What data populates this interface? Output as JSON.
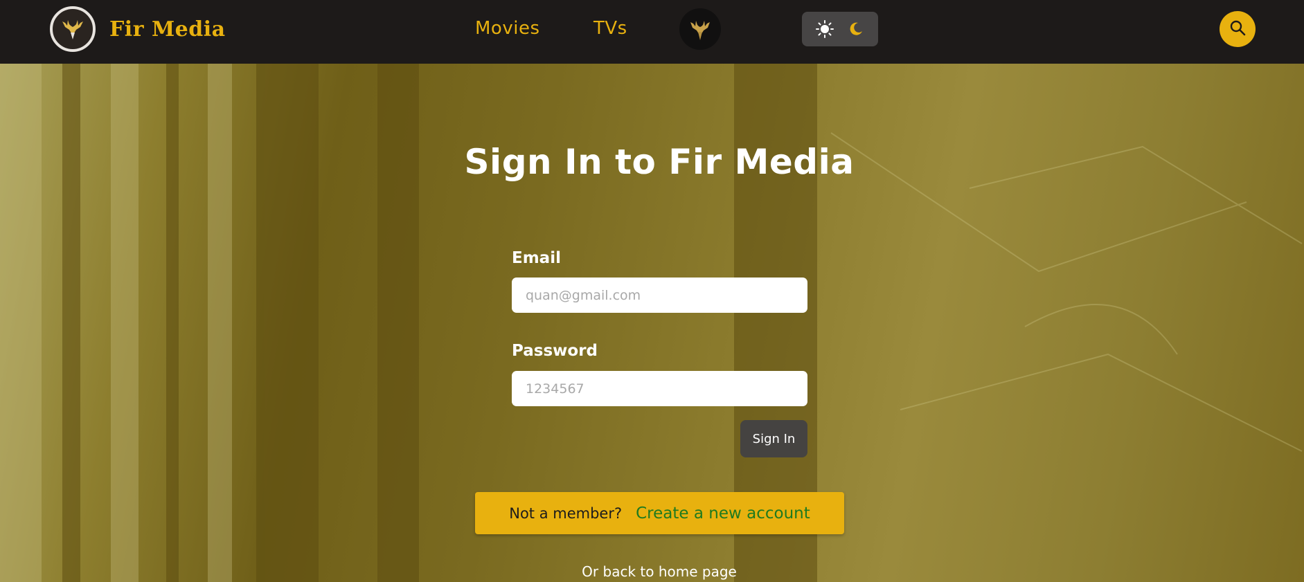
{
  "brand": {
    "name": "Fir Media",
    "logo_icon": "deer-logo-icon"
  },
  "nav": {
    "links": [
      {
        "label": "Movies"
      },
      {
        "label": "TVs"
      }
    ],
    "emblem_icon": "deer-emblem-icon",
    "theme_toggle": {
      "light_icon": "sun-icon",
      "dark_icon": "moon-icon"
    },
    "search_icon": "search-icon"
  },
  "form": {
    "title": "Sign In to Fir Media",
    "email": {
      "label": "Email",
      "placeholder": "quan@gmail.com",
      "value": ""
    },
    "password": {
      "label": "Password",
      "placeholder": "1234567",
      "value": ""
    },
    "submit_label": "Sign In"
  },
  "signup": {
    "prompt": "Not a member?",
    "link_label": "Create a new account"
  },
  "back_link": "Or back to home page",
  "colors": {
    "navbar_bg": "#1d1a19",
    "accent": "#e8b10f",
    "link_green": "#1f7a1f",
    "button_dark": "#454341"
  }
}
